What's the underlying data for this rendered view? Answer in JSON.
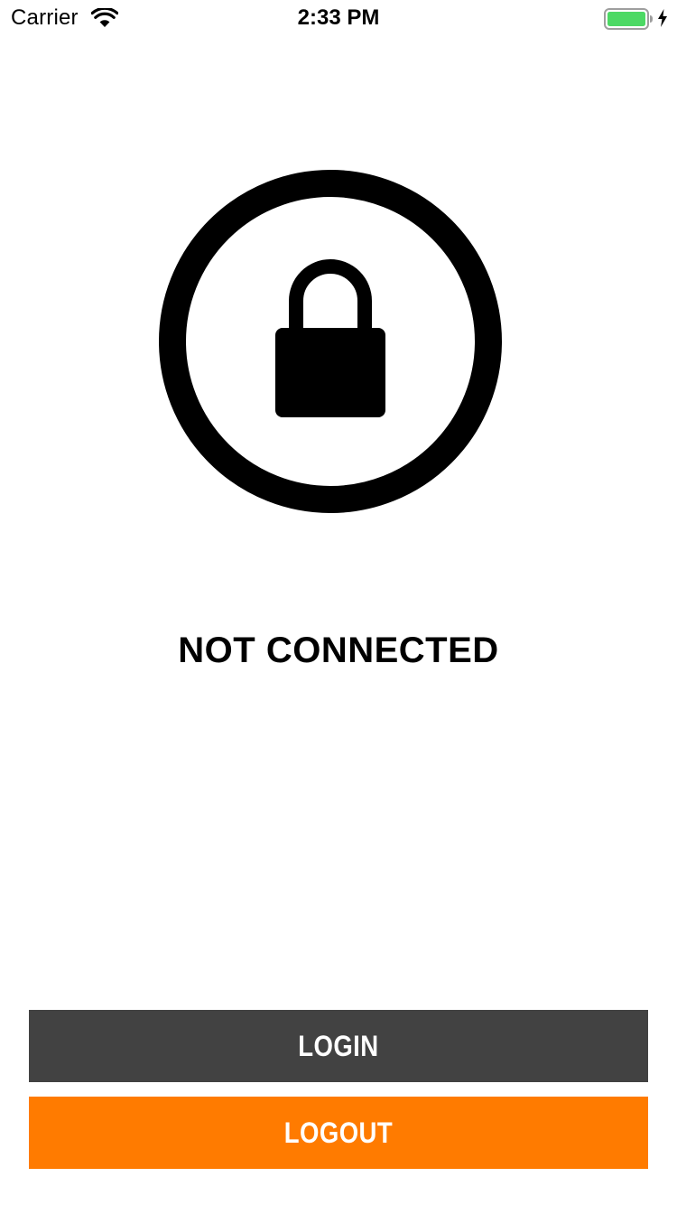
{
  "status_bar": {
    "carrier": "Carrier",
    "time": "2:33 PM",
    "wifi_icon": "wifi-icon",
    "battery_icon": "battery-icon",
    "charging_icon": "charging-bolt-icon",
    "battery_color": "#4cd964"
  },
  "main": {
    "emblem_icon": "lock-icon",
    "status_text": "NOT CONNECTED"
  },
  "buttons": {
    "login_label": "LOGIN",
    "login_color": "#424242",
    "logout_label": "LOGOUT",
    "logout_color": "#ff7b00"
  }
}
